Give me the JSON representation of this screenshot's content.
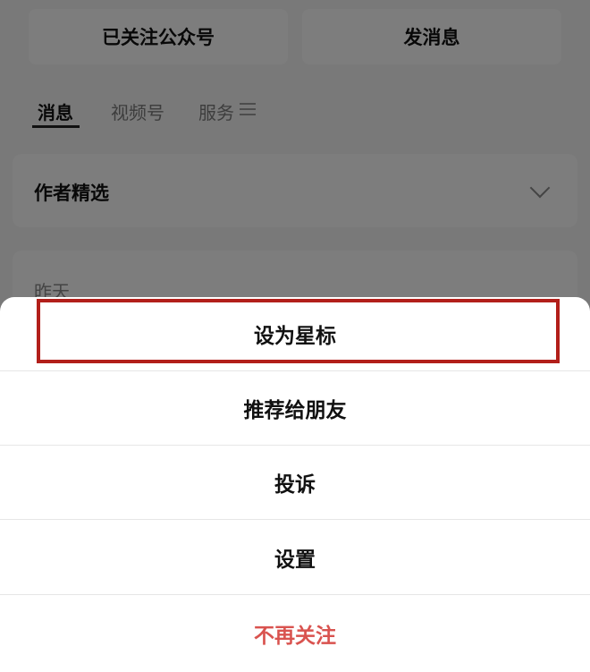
{
  "header": {
    "follow_label": "已关注公众号",
    "message_label": "发消息"
  },
  "tabs": [
    {
      "label": "消息",
      "active": true
    },
    {
      "label": "视频号",
      "active": false
    },
    {
      "label": "服务",
      "active": false
    }
  ],
  "author_section": {
    "title": "作者精选"
  },
  "feed": {
    "date": "昨天"
  },
  "action_sheet": {
    "items": [
      {
        "label": "设为星标",
        "highlighted": true
      },
      {
        "label": "推荐给朋友"
      },
      {
        "label": "投诉"
      },
      {
        "label": "设置"
      },
      {
        "label": "不再关注",
        "danger": true
      }
    ]
  },
  "colors": {
    "danger": "#d9534f",
    "highlight": "#b21f1a",
    "overlay": "rgba(0,0,0,0.5)"
  }
}
